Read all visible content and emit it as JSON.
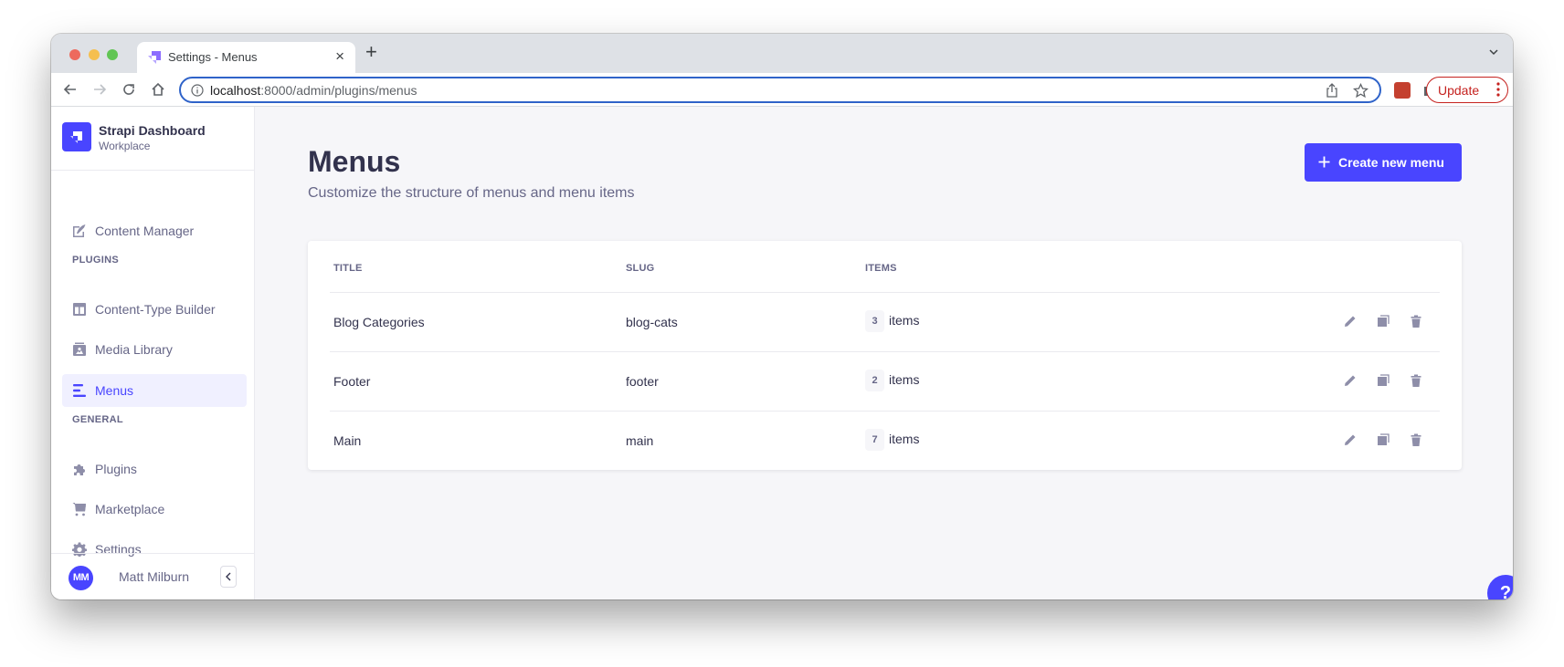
{
  "browser": {
    "tab_title": "Settings - Menus",
    "url_host": "localhost",
    "url_path": ":8000/admin/plugins/menus",
    "update_label": "Update"
  },
  "sidebar": {
    "brand_title": "Strapi Dashboard",
    "brand_subtitle": "Workplace",
    "items": [
      {
        "label": "Content Manager",
        "icon": "pencil-square-icon"
      },
      {
        "label": "Content-Type Builder",
        "icon": "layout-icon"
      },
      {
        "label": "Media Library",
        "icon": "image-icon"
      },
      {
        "label": "Menus",
        "icon": "menu-lines-icon",
        "active": true
      },
      {
        "label": "Plugins",
        "icon": "puzzle-icon"
      },
      {
        "label": "Marketplace",
        "icon": "cart-icon"
      },
      {
        "label": "Settings",
        "icon": "gear-icon"
      }
    ],
    "sections": {
      "plugins": "PLUGINS",
      "general": "GENERAL"
    },
    "user": {
      "initials": "MM",
      "name": "Matt Milburn"
    }
  },
  "main": {
    "title": "Menus",
    "subtitle": "Customize the structure of menus and menu items",
    "create_button": "Create new menu",
    "table": {
      "headers": [
        "TITLE",
        "SLUG",
        "ITEMS"
      ],
      "rows": [
        {
          "title": "Blog Categories",
          "slug": "blog-cats",
          "count": "3",
          "items_label": "items"
        },
        {
          "title": "Footer",
          "slug": "footer",
          "count": "2",
          "items_label": "items"
        },
        {
          "title": "Main",
          "slug": "main",
          "count": "7",
          "items_label": "items"
        }
      ]
    },
    "help_label": "?"
  },
  "colors": {
    "primary": "#4945ff",
    "text_dark": "#32324d",
    "text_muted": "#666687",
    "icon_muted": "#8e8ea9",
    "update_red": "#c5221f"
  }
}
